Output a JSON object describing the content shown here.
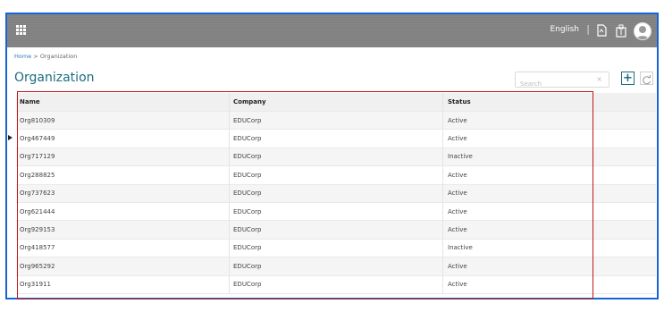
{
  "header": {
    "language": "English",
    "separator": "|",
    "icons": [
      "apps-grid-icon",
      "document-icon",
      "clipboard-icon",
      "user-avatar-icon"
    ]
  },
  "breadcrumb": {
    "home": "Home",
    "sep": ">",
    "current": "Organization"
  },
  "page": {
    "title": "Organization"
  },
  "search": {
    "placeholder": "Search",
    "clear": "×"
  },
  "toolbar": {
    "add": "+"
  },
  "table": {
    "columns": [
      "Name",
      "Company",
      "Status"
    ],
    "rows": [
      {
        "name": "Org810309",
        "company": "EDUCorp",
        "status": "Active"
      },
      {
        "name": "Org467449",
        "company": "EDUCorp",
        "status": "Active"
      },
      {
        "name": "Org717129",
        "company": "EDUCorp",
        "status": "Inactive"
      },
      {
        "name": "Org288825",
        "company": "EDUCorp",
        "status": "Active"
      },
      {
        "name": "Org737623",
        "company": "EDUCorp",
        "status": "Active"
      },
      {
        "name": "Org621444",
        "company": "EDUCorp",
        "status": "Active"
      },
      {
        "name": "Org929153",
        "company": "EDUCorp",
        "status": "Active"
      },
      {
        "name": "Org418577",
        "company": "EDUCorp",
        "status": "Inactive"
      },
      {
        "name": "Org965292",
        "company": "EDUCorp",
        "status": "Active"
      },
      {
        "name": "Org31911",
        "company": "EDUCorp",
        "status": "Active"
      }
    ]
  },
  "colors": {
    "topbar": "#808080",
    "accent": "#1b6d7f",
    "highlight": "#c2161c",
    "frame": "#1565d8"
  }
}
